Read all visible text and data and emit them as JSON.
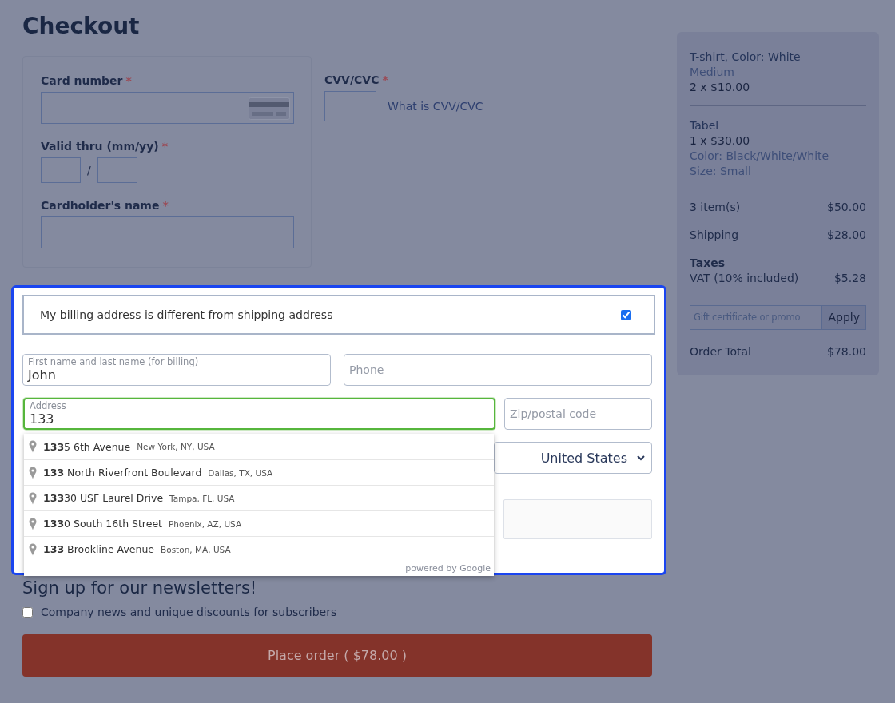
{
  "page": {
    "title": "Checkout"
  },
  "card_form": {
    "card_number": {
      "label": "Card number",
      "required_mark": "*"
    },
    "expiry": {
      "label": "Valid thru (mm/yy)",
      "required_mark": "*",
      "separator": "/"
    },
    "cardholder": {
      "label": "Cardholder's name",
      "required_mark": "*"
    },
    "cvv": {
      "label": "CVV/CVC",
      "required_mark": "*",
      "help_link": "What is CVV/CVC"
    }
  },
  "billing": {
    "toggle_label": "My billing address is different from shipping address",
    "checked": true,
    "name_field": {
      "label": "First name and last name (for billing)",
      "value": "John"
    },
    "phone_field": {
      "placeholder": "Phone"
    },
    "address_field": {
      "label": "Address",
      "value": "133",
      "focused": true
    },
    "zip_field": {
      "placeholder": "Zip/postal code"
    },
    "country_select": {
      "value": "United States"
    },
    "suggestions": [
      {
        "street": "**133**5 6th Avenue",
        "locality": "New York, NY, USA"
      },
      {
        "street": "**133** North Riverfront Boulevard",
        "locality": "Dallas, TX, USA"
      },
      {
        "street": "**133**30 USF Laurel Drive",
        "locality": "Tampa, FL, USA"
      },
      {
        "street": "**133**0 South 16th Street",
        "locality": "Phoenix, AZ, USA"
      },
      {
        "street": "**133** Brookline Avenue",
        "locality": "Boston, MA, USA"
      }
    ],
    "attribution": "powered by Google"
  },
  "newsletter": {
    "heading": "Sign up for our newsletters!",
    "option": {
      "label": "Company news and unique discounts for subscribers",
      "checked": false
    }
  },
  "place_order": {
    "label": "Place order ( $78.00 )"
  },
  "summary": {
    "items": [
      {
        "name": "T-shirt, Color: White",
        "lines": [
          {
            "kind": "variant",
            "text": "Medium"
          },
          {
            "kind": "quantity",
            "text": "2 x $10.00"
          }
        ]
      },
      {
        "name": "Tabel",
        "lines": [
          {
            "kind": "quantity",
            "text": "1 x $30.00"
          },
          {
            "kind": "variant",
            "text": "Color: Black/White/White"
          },
          {
            "kind": "variant",
            "text": "Size: Small"
          }
        ]
      }
    ],
    "totals": [
      {
        "label": "3 item(s)",
        "amount": "$50.00"
      },
      {
        "label": "Shipping",
        "amount": "$28.00"
      }
    ],
    "taxes": {
      "heading": "Taxes",
      "rows": [
        {
          "label": "VAT (10% included)",
          "amount": "$5.28"
        }
      ]
    },
    "promo": {
      "placeholder": "Gift certificate or promo",
      "button": "Apply"
    },
    "order_total": {
      "label": "Order Total",
      "amount": "$78.00"
    }
  }
}
